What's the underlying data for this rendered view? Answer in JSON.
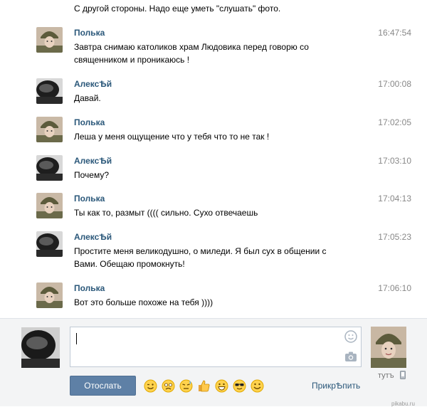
{
  "thread": {
    "previous_text": "С другой стороны. Надо еще уметь \"слушать\" фото.",
    "messages": [
      {
        "author": "Полька",
        "time": "16:47:54",
        "lines": [
          "Завтра снимаю католиков храм Людовика перед говорю со",
          "священником и проникаюсь !"
        ]
      },
      {
        "author": "АлексѢй",
        "time": "17:00:08",
        "lines": [
          "Давай."
        ]
      },
      {
        "author": "Полька",
        "time": "17:02:05",
        "lines": [
          "Леша у меня ощущение что у тебя что то не так !"
        ]
      },
      {
        "author": "АлексѢй",
        "time": "17:03:10",
        "lines": [
          "Почему?"
        ]
      },
      {
        "author": "Полька",
        "time": "17:04:13",
        "lines": [
          "Ты как то, размыт (((( сильно. Сухо отвечаешь"
        ]
      },
      {
        "author": "АлексѢй",
        "time": "17:05:23",
        "lines": [
          "Простите меня великодушно, о миледи. Я был сух в общении с",
          "Вами. Обещаю промокнуть!"
        ]
      },
      {
        "author": "Полька",
        "time": "17:06:10",
        "lines": [
          "Вот это больше похоже на тебя ))))"
        ]
      }
    ]
  },
  "composer": {
    "input_value": "",
    "send_label": "Отослать",
    "attach_label": "ПрикрѢпить",
    "peer_status": "тутъ",
    "watermark": "pikabu.ru",
    "emojis": [
      "wink-emoji",
      "crying-emoji",
      "sweat-emoji",
      "thumbs-up-emoji",
      "grin-emoji",
      "sunglasses-emoji",
      "smile-emoji"
    ]
  },
  "colors": {
    "link": "#2b587a",
    "button": "#5e80a6",
    "composer_bg": "#f3f4f5"
  }
}
